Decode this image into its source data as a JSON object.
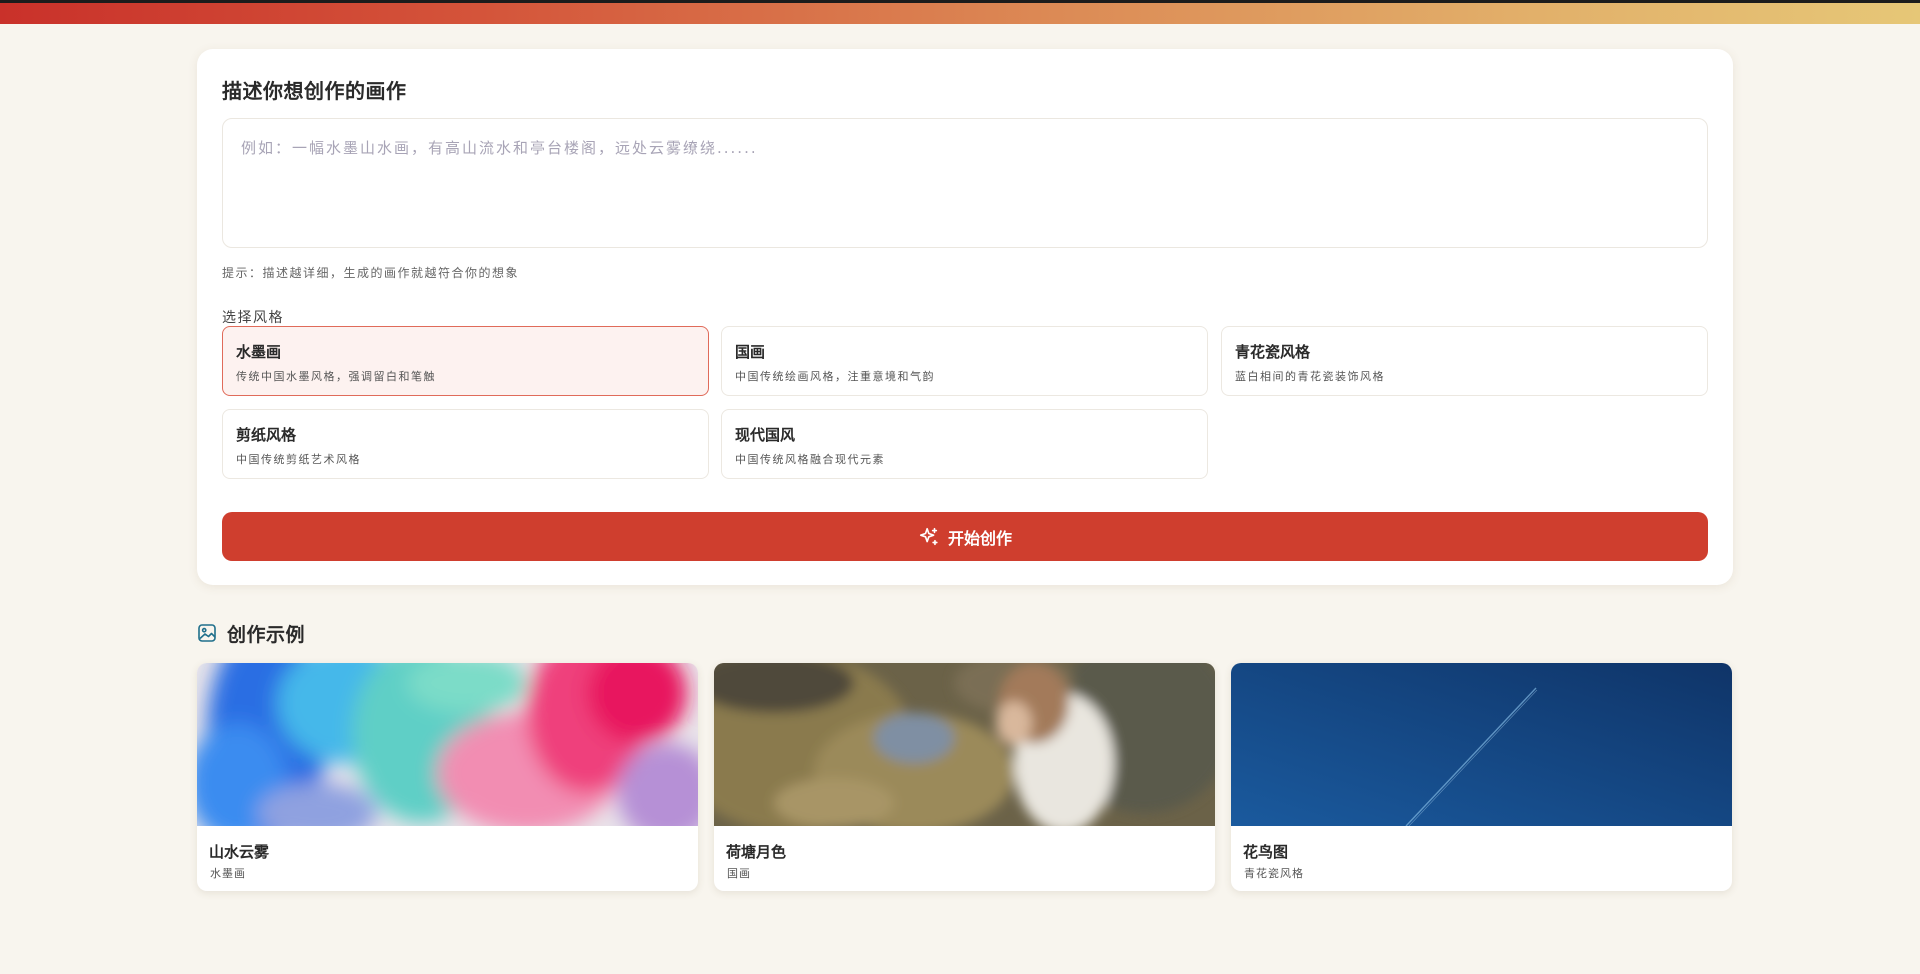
{
  "form": {
    "title": "描述你想创作的画作",
    "prompt_placeholder": "例如：一幅水墨山水画，有高山流水和亭台楼阁，远处云雾缭绕......",
    "prompt_value": "",
    "hint": "提示：描述越详细，生成的画作就越符合你的想象",
    "style_label": "选择风格",
    "selected_style": "水墨画",
    "styles": [
      {
        "name": "水墨画",
        "desc": "传统中国水墨风格，强调留白和笔触"
      },
      {
        "name": "国画",
        "desc": "中国传统绘画风格，注重意境和气韵"
      },
      {
        "name": "青花瓷风格",
        "desc": "蓝白相间的青花瓷装饰风格"
      },
      {
        "name": "剪纸风格",
        "desc": "中国传统剪纸艺术风格"
      },
      {
        "name": "现代国风",
        "desc": "中国传统风格融合现代元素"
      }
    ],
    "create_label": "开始创作",
    "create_icon": "sparkle-icon"
  },
  "examples": {
    "title": "创作示例",
    "icon": "image-icon",
    "items": [
      {
        "title": "山水云雾",
        "style": "水墨画"
      },
      {
        "title": "荷塘月色",
        "style": "国画"
      },
      {
        "title": "花鸟图",
        "style": "青花瓷风格"
      }
    ]
  },
  "colors": {
    "accent": "#cf3e2e",
    "page_background": "#f8f5ee",
    "selected_card_border": "#e06b5a",
    "selected_card_background": "#fdf2f0"
  }
}
